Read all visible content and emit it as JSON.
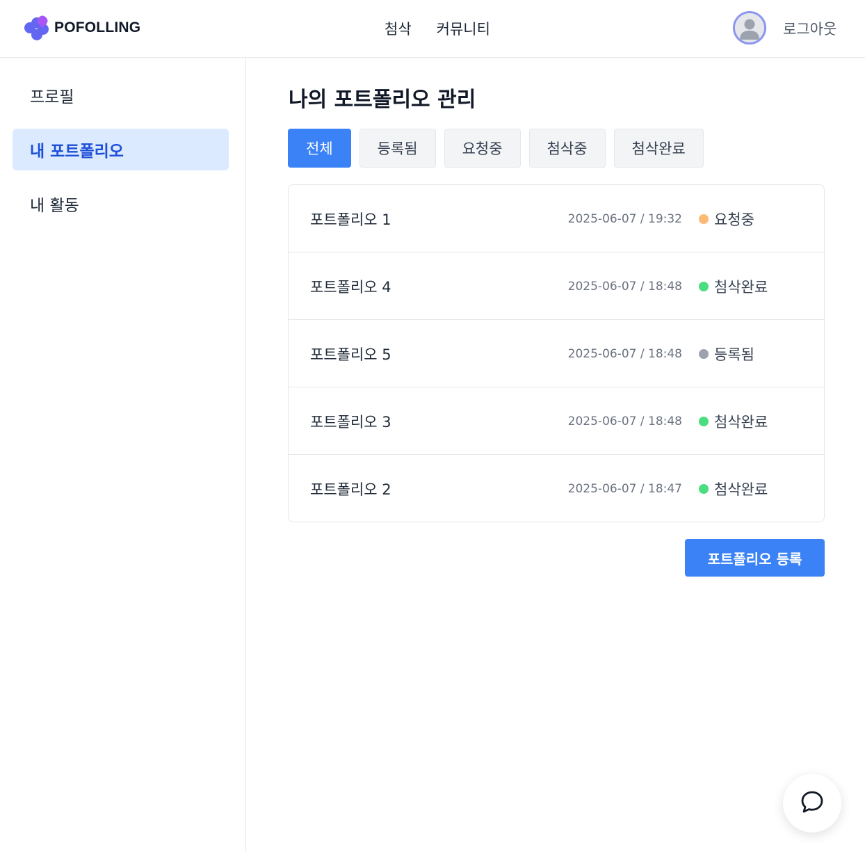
{
  "header": {
    "logo_text": "POFOLLING",
    "nav": [
      {
        "label": "첨삭"
      },
      {
        "label": "커뮤니티"
      }
    ],
    "avatar_icon": "user-avatar-icon",
    "logout_label": "로그아웃"
  },
  "sidebar": {
    "items": [
      {
        "label": "프로필",
        "active": false
      },
      {
        "label": "내 포트폴리오",
        "active": true
      },
      {
        "label": "내 활동",
        "active": false
      }
    ]
  },
  "main": {
    "title": "나의 포트폴리오 관리",
    "tabs": [
      {
        "label": "전체",
        "active": true
      },
      {
        "label": "등록됨",
        "active": false
      },
      {
        "label": "요청중",
        "active": false
      },
      {
        "label": "첨삭중",
        "active": false
      },
      {
        "label": "첨삭완료",
        "active": false
      }
    ],
    "portfolios": [
      {
        "title": "포트폴리오 1",
        "date": "2025-06-07 / 19:32",
        "status": "요청중",
        "status_color": "#fdba74"
      },
      {
        "title": "포트폴리오 4",
        "date": "2025-06-07 / 18:48",
        "status": "첨삭완료",
        "status_color": "#4ade80"
      },
      {
        "title": "포트폴리오 5",
        "date": "2025-06-07 / 18:48",
        "status": "등록됨",
        "status_color": "#9ca3af"
      },
      {
        "title": "포트폴리오 3",
        "date": "2025-06-07 / 18:48",
        "status": "첨삭완료",
        "status_color": "#4ade80"
      },
      {
        "title": "포트폴리오 2",
        "date": "2025-06-07 / 18:47",
        "status": "첨삭완료",
        "status_color": "#4ade80"
      }
    ],
    "register_label": "포트폴리오 등록"
  },
  "chat": {
    "icon": "chat-bubble-icon"
  },
  "colors": {
    "accent": "#3b82f6",
    "active_bg": "#dbeafe",
    "active_text": "#1d4ed8"
  }
}
